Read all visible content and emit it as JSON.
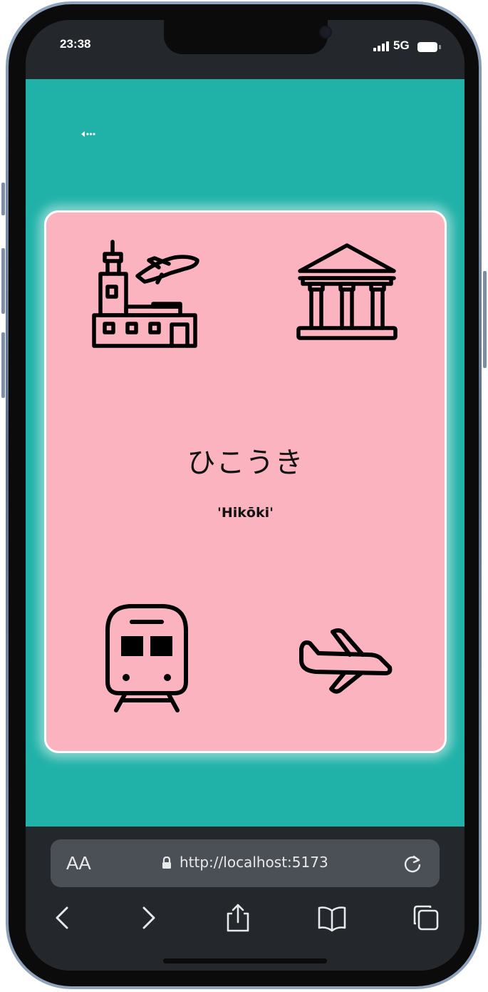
{
  "status_bar": {
    "time": "23:38",
    "network": "5G"
  },
  "page": {
    "background_color": "#20b2a8",
    "back_button_icon": "back-arrow-dotted-icon"
  },
  "card": {
    "background_color": "#fbb3bf",
    "kana": "ひこうき",
    "romaji": "'Hikōki'",
    "choices": [
      {
        "icon": "airport-icon"
      },
      {
        "icon": "museum-icon"
      },
      {
        "icon": "train-icon"
      },
      {
        "icon": "airplane-icon"
      }
    ]
  },
  "browser": {
    "text_size_label": "AA",
    "url": "http://localhost:5173",
    "toolbar_icons": [
      "back-icon",
      "forward-icon",
      "share-icon",
      "bookmarks-icon",
      "tabs-icon"
    ]
  }
}
